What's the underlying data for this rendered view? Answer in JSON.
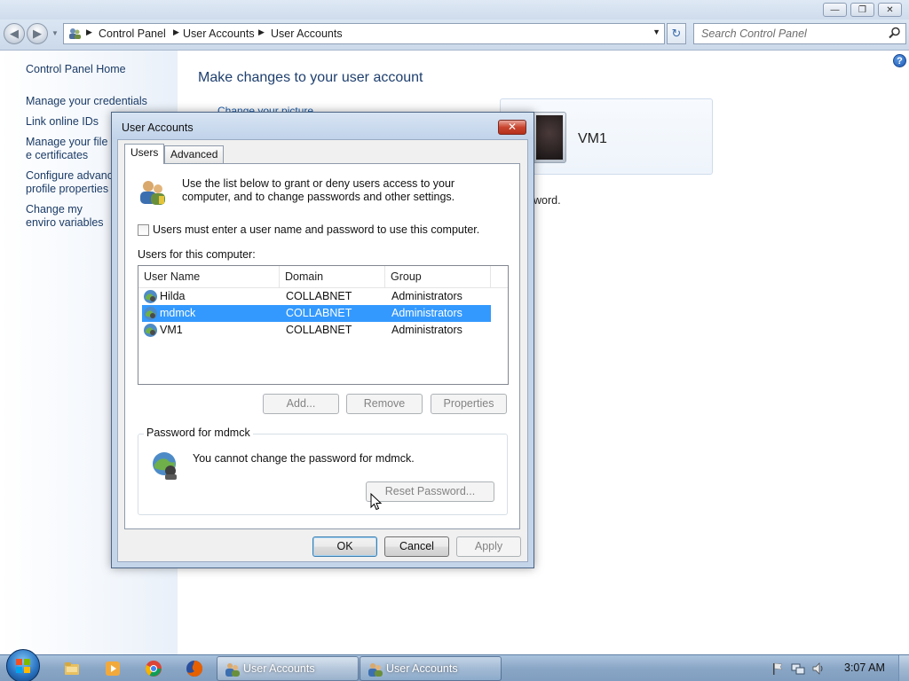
{
  "explorer": {
    "breadcrumbs": [
      "Control Panel",
      "User Accounts",
      "User Accounts"
    ],
    "search_placeholder": "Search Control Panel"
  },
  "left_pane": {
    "items": [
      {
        "label": "Control Panel Home"
      },
      {
        "label": "Manage your credentials"
      },
      {
        "label": "Link online IDs"
      },
      {
        "label": "Manage your file e certificates"
      },
      {
        "label": "Configure advanc profile properties"
      },
      {
        "label": "Change my enviro variables"
      }
    ]
  },
  "main": {
    "title": "Make changes to your user account",
    "link_partial": "Change your picture",
    "user_name": "VM1",
    "text_partial": "word."
  },
  "dialog": {
    "title": "User Accounts",
    "tabs": [
      {
        "label": "Users",
        "active": true
      },
      {
        "label": "Advanced",
        "active": false
      }
    ],
    "description": "Use the list below to grant or deny users access to your computer, and to change passwords and other settings.",
    "checkbox_label": "Users must enter a user name and password to use this computer.",
    "checkbox_checked": false,
    "list_label": "Users for this computer:",
    "columns": [
      "User Name",
      "Domain",
      "Group"
    ],
    "users": [
      {
        "name": "Hilda",
        "domain": "COLLABNET",
        "group": "Administrators",
        "selected": false
      },
      {
        "name": "mdmck",
        "domain": "COLLABNET",
        "group": "Administrators",
        "selected": true
      },
      {
        "name": "VM1",
        "domain": "COLLABNET",
        "group": "Administrators",
        "selected": false
      }
    ],
    "buttons": {
      "add": "Add...",
      "remove": "Remove",
      "properties": "Properties"
    },
    "password_group": {
      "legend": "Password for mdmck",
      "message": "You cannot change the password for mdmck.",
      "reset_button": "Reset Password..."
    },
    "footer": {
      "ok": "OK",
      "cancel": "Cancel",
      "apply": "Apply"
    }
  },
  "taskbar": {
    "tasks": [
      {
        "label": "User Accounts"
      },
      {
        "label": "User Accounts"
      }
    ],
    "clock": "3:07 AM"
  },
  "colors": {
    "selection": "#3399ff",
    "link": "#1b3b66",
    "title": "#1e3f6e"
  }
}
